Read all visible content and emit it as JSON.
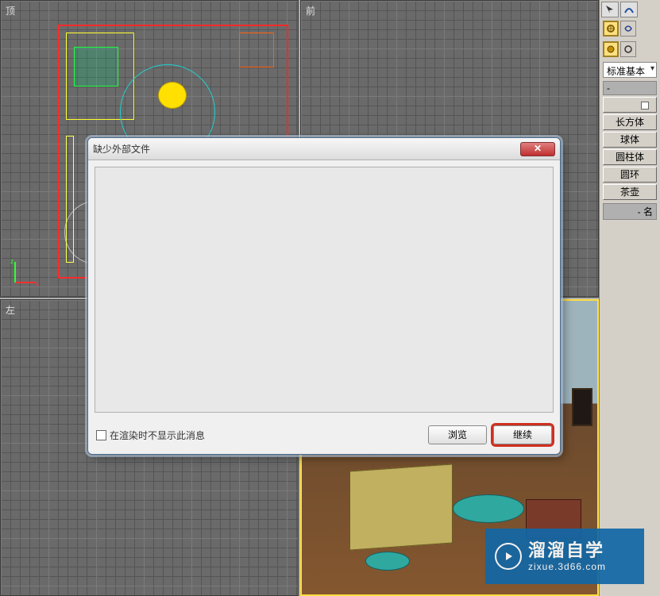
{
  "viewports": {
    "top_label": "顶",
    "front_label": "前",
    "left_label": "左"
  },
  "side_panel": {
    "dropdown": "标准基本",
    "rollup_object_type": "-",
    "rollup_name_color": "-           名",
    "object_buttons": {
      "box": "长方体",
      "sphere": "球体",
      "cylinder": "圆柱体",
      "torus": "圆环",
      "teapot": "茶壶"
    }
  },
  "dialog": {
    "title": "缺少外部文件",
    "checkbox_label": "在渲染时不显示此消息",
    "browse": "浏览",
    "continue": "继续"
  },
  "watermark": {
    "main": "溜溜自学",
    "sub": "zixue.3d66.com"
  }
}
